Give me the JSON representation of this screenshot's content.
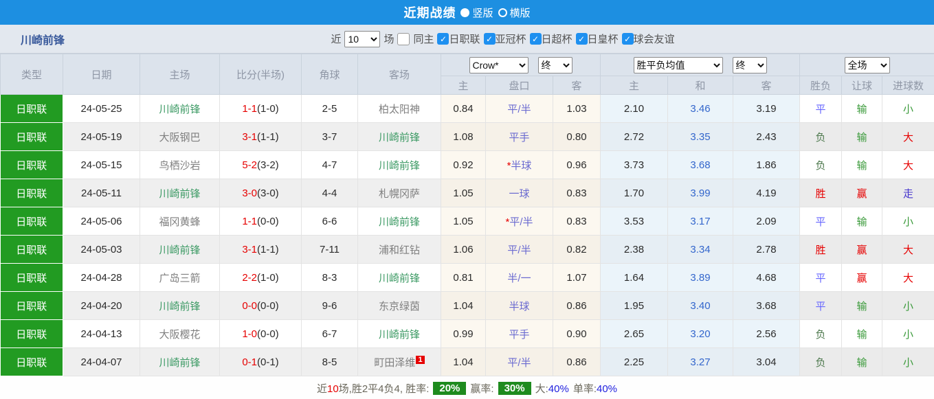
{
  "titlebar": {
    "title": "近期战绩",
    "vertical_label": "竖版",
    "horizontal_label": "横版",
    "selected_layout": "竖版"
  },
  "filter": {
    "team": "川崎前锋",
    "recent_label": "近",
    "count_value": "10",
    "games_label": "场",
    "same_home_label": "同主",
    "leagues": [
      "日职联",
      "亚冠杯",
      "日超杯",
      "日皇杯",
      "球会友谊"
    ]
  },
  "table": {
    "headers": {
      "type": "类型",
      "date": "日期",
      "home": "主场",
      "score": "比分(半场)",
      "corner": "角球",
      "away": "客场",
      "sub": [
        "主",
        "盘口",
        "客",
        "主",
        "和",
        "客",
        "胜负",
        "让球",
        "进球数"
      ]
    },
    "dropdowns": {
      "company": "Crow*",
      "company_state": "终",
      "odds_type": "胜平负均值",
      "odds_state": "终",
      "scope": "全场"
    },
    "rows": [
      {
        "league": "日职联",
        "date": "24-05-25",
        "home": "川崎前锋",
        "home_class": "t-self",
        "home_badge": "",
        "score": "1-1",
        "half": "(1-0)",
        "corner": "2-5",
        "away": "柏太阳神",
        "away_class": "t-opp",
        "away_badge": "",
        "crow_home": "0.84",
        "hstar": "",
        "handicap": "平/半",
        "crow_away": "1.03",
        "odds_home": "2.10",
        "odds_draw": "3.46",
        "odds_away": "3.19",
        "wl": "平",
        "wl_class": "t-blue",
        "rq": "输",
        "rq_class": "t-green",
        "goal": "小",
        "goal_class": "t-green"
      },
      {
        "league": "日职联",
        "date": "24-05-19",
        "home": "大阪钢巴",
        "home_class": "t-opp",
        "home_badge": "",
        "score": "3-1",
        "half": "(1-1)",
        "corner": "3-7",
        "away": "川崎前锋",
        "away_class": "t-self",
        "away_badge": "",
        "crow_home": "1.08",
        "hstar": "",
        "handicap": "平手",
        "crow_away": "0.80",
        "odds_home": "2.72",
        "odds_draw": "3.35",
        "odds_away": "2.43",
        "wl": "负",
        "wl_class": "t-dgreen",
        "rq": "输",
        "rq_class": "t-green",
        "goal": "大",
        "goal_class": "t-red"
      },
      {
        "league": "日职联",
        "date": "24-05-15",
        "home": "鸟栖沙岩",
        "home_class": "t-opp",
        "home_badge": "",
        "score": "5-2",
        "half": "(3-2)",
        "corner": "4-7",
        "away": "川崎前锋",
        "away_class": "t-self",
        "away_badge": "",
        "crow_home": "0.92",
        "hstar": "*",
        "handicap": "半球",
        "crow_away": "0.96",
        "odds_home": "3.73",
        "odds_draw": "3.68",
        "odds_away": "1.86",
        "wl": "负",
        "wl_class": "t-dgreen",
        "rq": "输",
        "rq_class": "t-green",
        "goal": "大",
        "goal_class": "t-red"
      },
      {
        "league": "日职联",
        "date": "24-05-11",
        "home": "川崎前锋",
        "home_class": "t-self",
        "home_badge": "",
        "score": "3-0",
        "half": "(3-0)",
        "corner": "4-4",
        "away": "札幌冈萨",
        "away_class": "t-opp",
        "away_badge": "",
        "crow_home": "1.05",
        "hstar": "",
        "handicap": "一球",
        "crow_away": "0.83",
        "odds_home": "1.70",
        "odds_draw": "3.99",
        "odds_away": "4.19",
        "wl": "胜",
        "wl_class": "t-red",
        "rq": "赢",
        "rq_class": "t-red",
        "goal": "走",
        "goal_class": "t-purple"
      },
      {
        "league": "日职联",
        "date": "24-05-06",
        "home": "福冈黄蜂",
        "home_class": "t-opp",
        "home_badge": "",
        "score": "1-1",
        "half": "(0-0)",
        "corner": "6-6",
        "away": "川崎前锋",
        "away_class": "t-self",
        "away_badge": "",
        "crow_home": "1.05",
        "hstar": "*",
        "handicap": "平/半",
        "crow_away": "0.83",
        "odds_home": "3.53",
        "odds_draw": "3.17",
        "odds_away": "2.09",
        "wl": "平",
        "wl_class": "t-blue",
        "rq": "输",
        "rq_class": "t-green",
        "goal": "小",
        "goal_class": "t-green"
      },
      {
        "league": "日职联",
        "date": "24-05-03",
        "home": "川崎前锋",
        "home_class": "t-self",
        "home_badge": "",
        "score": "3-1",
        "half": "(1-1)",
        "corner": "7-11",
        "away": "浦和红钻",
        "away_class": "t-opp",
        "away_badge": "",
        "crow_home": "1.06",
        "hstar": "",
        "handicap": "平/半",
        "crow_away": "0.82",
        "odds_home": "2.38",
        "odds_draw": "3.34",
        "odds_away": "2.78",
        "wl": "胜",
        "wl_class": "t-red",
        "rq": "赢",
        "rq_class": "t-red",
        "goal": "大",
        "goal_class": "t-red"
      },
      {
        "league": "日职联",
        "date": "24-04-28",
        "home": "广岛三箭",
        "home_class": "t-opp",
        "home_badge": "",
        "score": "2-2",
        "half": "(1-0)",
        "corner": "8-3",
        "away": "川崎前锋",
        "away_class": "t-self",
        "away_badge": "",
        "crow_home": "0.81",
        "hstar": "",
        "handicap": "半/一",
        "crow_away": "1.07",
        "odds_home": "1.64",
        "odds_draw": "3.89",
        "odds_away": "4.68",
        "wl": "平",
        "wl_class": "t-blue",
        "rq": "赢",
        "rq_class": "t-red",
        "goal": "大",
        "goal_class": "t-red"
      },
      {
        "league": "日职联",
        "date": "24-04-20",
        "home": "川崎前锋",
        "home_class": "t-self",
        "home_badge": "",
        "score": "0-0",
        "half": "(0-0)",
        "corner": "9-6",
        "away": "东京绿茵",
        "away_class": "t-opp",
        "away_badge": "",
        "crow_home": "1.04",
        "hstar": "",
        "handicap": "半球",
        "crow_away": "0.86",
        "odds_home": "1.95",
        "odds_draw": "3.40",
        "odds_away": "3.68",
        "wl": "平",
        "wl_class": "t-blue",
        "rq": "输",
        "rq_class": "t-green",
        "goal": "小",
        "goal_class": "t-green"
      },
      {
        "league": "日职联",
        "date": "24-04-13",
        "home": "大阪樱花",
        "home_class": "t-opp",
        "home_badge": "",
        "score": "1-0",
        "half": "(0-0)",
        "corner": "6-7",
        "away": "川崎前锋",
        "away_class": "t-self",
        "away_badge": "",
        "crow_home": "0.99",
        "hstar": "",
        "handicap": "平手",
        "crow_away": "0.90",
        "odds_home": "2.65",
        "odds_draw": "3.20",
        "odds_away": "2.56",
        "wl": "负",
        "wl_class": "t-dgreen",
        "rq": "输",
        "rq_class": "t-green",
        "goal": "小",
        "goal_class": "t-green"
      },
      {
        "league": "日职联",
        "date": "24-04-07",
        "home": "川崎前锋",
        "home_class": "t-self",
        "home_badge": "",
        "score": "0-1",
        "half": "(0-1)",
        "corner": "8-5",
        "away": "町田泽维",
        "away_class": "t-opp",
        "away_badge": "1",
        "crow_home": "1.04",
        "hstar": "",
        "handicap": "平/半",
        "crow_away": "0.86",
        "odds_home": "2.25",
        "odds_draw": "3.27",
        "odds_away": "3.04",
        "wl": "负",
        "wl_class": "t-dgreen",
        "rq": "输",
        "rq_class": "t-green",
        "goal": "小",
        "goal_class": "t-green"
      }
    ]
  },
  "footer": {
    "recent_label": "近",
    "recent_count": "10",
    "summary": "场,胜2平4负4, 胜率:",
    "win_rate": "20%",
    "handicap_label": "赢率:",
    "handicap_rate": "30%",
    "big_label": "大:",
    "big_rate": "40%",
    "odd_label": "单率:",
    "odd_rate": "40%"
  },
  "colors": {
    "accent_blue": "#1D8FE1",
    "league_green": "#229B22",
    "badge_green": "#1E8B1E",
    "loss_red": "#E60000",
    "handicap_purple": "#6A6AD0",
    "draw_odds_blue": "#3366CC",
    "self_team_green": "#3C9A64",
    "checkbox_blue": "#1E90F0"
  }
}
